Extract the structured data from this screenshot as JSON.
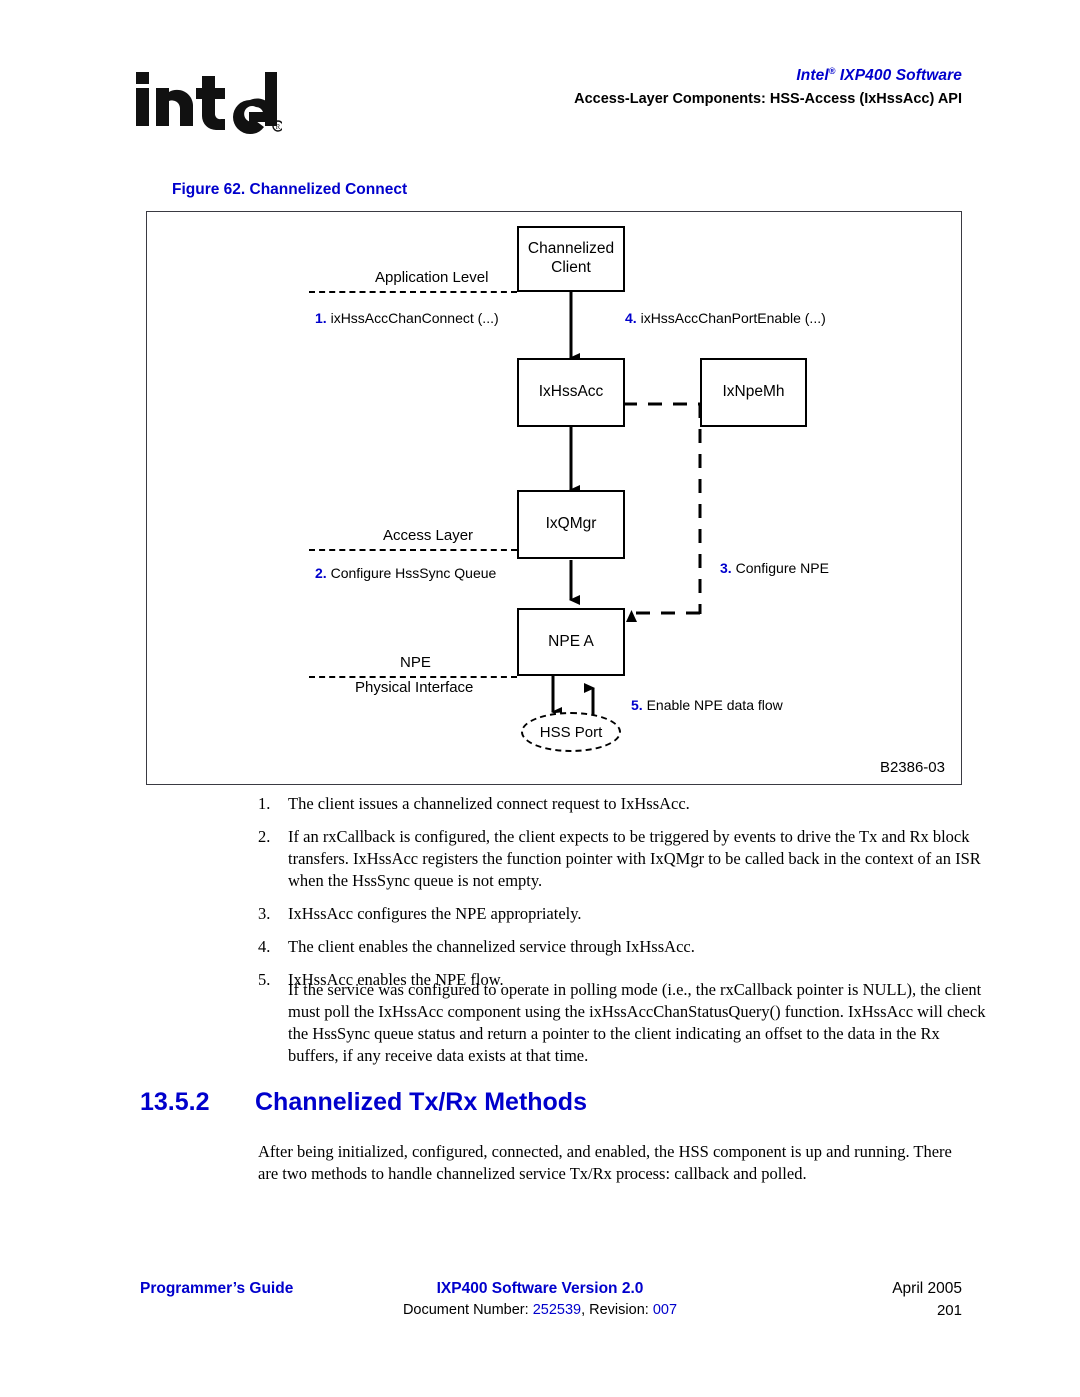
{
  "header": {
    "logo_text": "intel",
    "logo_mark": "®",
    "title_brand": "Intel",
    "title_brand_sup": "®",
    "title_product": " IXP400 Software",
    "subtitle": "Access-Layer Components: HSS-Access (IxHssAcc) API",
    "accent_color": "#0000CC"
  },
  "figure": {
    "caption": "Figure 62. Channelized Connect",
    "id_label": "B2386-03",
    "boxes": [
      {
        "name": "channelized-client",
        "label": "Channelized\nClient"
      },
      {
        "name": "ixhssacc",
        "label": "IxHssAcc"
      },
      {
        "name": "ixnpemh",
        "label": "IxNpeMh"
      },
      {
        "name": "ixqmgr",
        "label": "IxQMgr"
      },
      {
        "name": "npe-a",
        "label": "NPE A"
      },
      {
        "name": "hss-port",
        "label": "HSS Port"
      }
    ],
    "layer_labels": [
      {
        "name": "application-level",
        "label": "Application Level"
      },
      {
        "name": "access-layer",
        "label": "Access Layer"
      },
      {
        "name": "npe",
        "label": "NPE"
      },
      {
        "name": "physical-interface",
        "label": "Physical Interface"
      }
    ],
    "steps": [
      {
        "num": "1.",
        "text": " ixHssAccChanConnect (...)"
      },
      {
        "num": "4.",
        "text": " ixHssAccChanPortEnable (...)"
      },
      {
        "num": "2.",
        "text": " Configure HssSync Queue"
      },
      {
        "num": "3.",
        "text": " Configure NPE"
      },
      {
        "num": "5.",
        "text": " Enable NPE data flow"
      }
    ]
  },
  "list": {
    "items": [
      {
        "n": "1.",
        "text": "The client issues a channelized connect request to IxHssAcc."
      },
      {
        "n": "2.",
        "text": "If an rxCallback is configured, the client expects to be triggered by events to drive the Tx and Rx block transfers. IxHssAcc registers the function pointer with IxQMgr to be called back in the context of an ISR when the HssSync queue is not empty."
      },
      {
        "n": "3.",
        "text": "IxHssAcc configures the NPE appropriately."
      },
      {
        "n": "4.",
        "text": "The client enables the channelized service through IxHssAcc."
      },
      {
        "n": "5.",
        "text": "IxHssAcc enables the NPE flow."
      }
    ],
    "polling_paragraph": "If the service was configured to operate in polling mode (i.e., the rxCallback pointer is NULL), the client must poll the IxHssAcc component using the ixHssAccChanStatusQuery() function. IxHssAcc will check the HssSync queue status and return a pointer to the client indicating an offset to the data in the Rx buffers, if any receive data exists at that time."
  },
  "section": {
    "number": "13.5.2",
    "title": "Channelized Tx/Rx Methods",
    "paragraph": "After being initialized, configured, connected, and enabled, the HSS component is up and running. There are two methods to handle channelized service Tx/Rx process: callback and polled."
  },
  "footer": {
    "left": "Programmer’s Guide",
    "center_line1": "IXP400 Software Version 2.0",
    "center_line2_prefix": "Document Number: ",
    "center_line2_docnum": "252539",
    "center_line2_mid": ", Revision: ",
    "center_line2_rev": "007",
    "right_line1": "April 2005",
    "right_line2": "201"
  }
}
